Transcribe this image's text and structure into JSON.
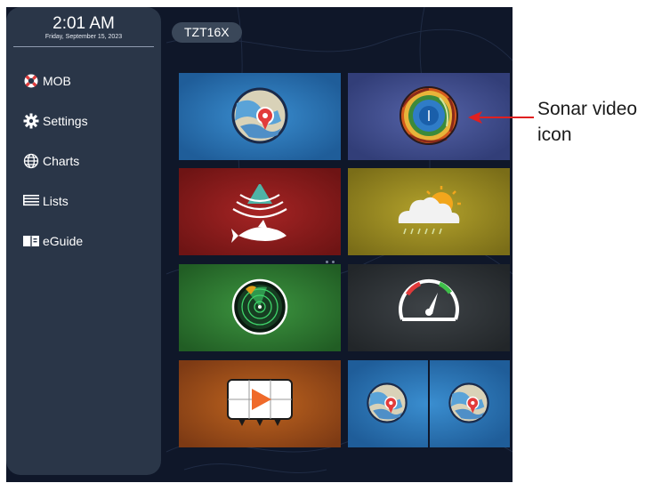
{
  "clock": {
    "time": "2:01 AM",
    "date": "Friday, September 15, 2023"
  },
  "sidebar": {
    "items": [
      {
        "label": "MOB",
        "icon": "lifebuoy-icon"
      },
      {
        "label": "Settings",
        "icon": "gear-icon"
      },
      {
        "label": "Charts",
        "icon": "globe-icon"
      },
      {
        "label": "Lists",
        "icon": "list-icon"
      },
      {
        "label": "eGuide",
        "icon": "book-icon"
      }
    ]
  },
  "header": {
    "device": "TZT16X"
  },
  "tiles": [
    {
      "name": "chart-plotter",
      "icon": "chart-pin-icon"
    },
    {
      "name": "sonar-video",
      "icon": "sonar-video-icon"
    },
    {
      "name": "fish-finder",
      "icon": "fish-finder-icon"
    },
    {
      "name": "weather",
      "icon": "weather-icon"
    },
    {
      "name": "radar",
      "icon": "radar-icon"
    },
    {
      "name": "instruments",
      "icon": "gauge-icon"
    },
    {
      "name": "video",
      "icon": "video-play-icon"
    },
    {
      "name": "dual-chart",
      "icon": "dual-chart-icon"
    }
  ],
  "callout": {
    "line1": "Sonar video",
    "line2": "icon"
  },
  "colors": {
    "screen": "#0f1729",
    "sidebar": "#2a3648",
    "chart_tile": "#2b72b0",
    "sonar_tile": "#3f4c88",
    "fish_tile": "#8d1a1a",
    "weather_tile": "#9a8b22",
    "radar_tile": "#2e7a32",
    "instrument_tile": "#2f3336",
    "video_tile": "#a5501d",
    "arrow": "#e02020"
  }
}
